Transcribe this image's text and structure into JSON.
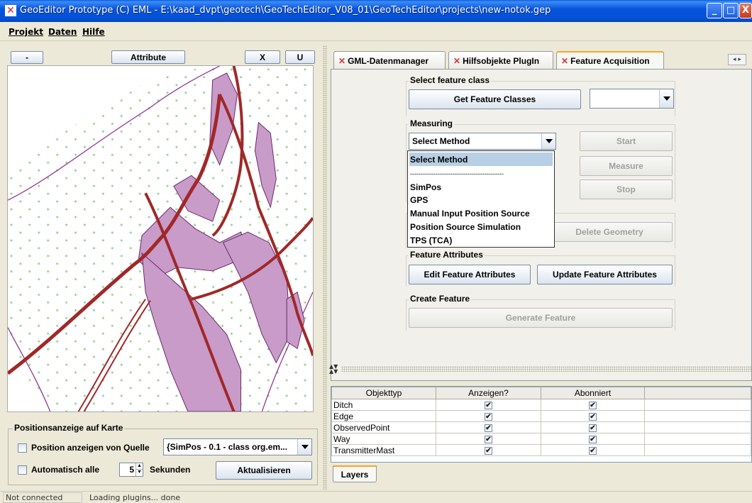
{
  "window": {
    "title": "GeoEditor Prototype (C) EML - E:\\kaad_dvpt\\geotech\\GeoTechEditor_V08_01\\GeoTechEditor\\projects\\new-notok.gep",
    "minimize": "_",
    "maximize": "□",
    "close": "X"
  },
  "menu": {
    "items": [
      "Projekt",
      "Daten",
      "Hilfe"
    ]
  },
  "left": {
    "minus_button": "-",
    "attribute_button": "Attribute",
    "x_button": "X",
    "u_button": "U",
    "position_group_title": "Positionsanzeige auf Karte",
    "show_position_label": "Position anzeigen von Quelle",
    "source_combo_value": "{SimPos - 0.1 - class org.em...",
    "auto_all_label": "Automatisch alle",
    "seconds_value": "5",
    "seconds_label": "Sekunden",
    "refresh_button": "Aktualisieren"
  },
  "tabs": [
    "GML-Datenmanager",
    "Hilfsobjekte PlugIn",
    "Feature Acquisition"
  ],
  "active_tab": "Feature Acquisition",
  "feature": {
    "select_class_title": "Select feature class",
    "get_classes_button": "Get Feature Classes",
    "class_combo_value": "",
    "measuring_title": "Measuring",
    "method_combo_value": "Select Method",
    "start_button": "Start",
    "measure_button": "Measure",
    "stop_button": "Stop",
    "delete_geometry_button": "Delete Geometry",
    "attributes_title": "Feature Attributes",
    "edit_attributes_button": "Edit Feature Attributes",
    "update_attributes_button": "Update Feature Attributes",
    "create_title": "Create Feature",
    "generate_button": "Generate Feature"
  },
  "method_options": [
    "Select Method",
    "--------------------------------------------",
    "SimPos",
    "GPS",
    "Manual Input Position Source",
    "Position Source Simulation",
    "TPS (TCA)"
  ],
  "layers": {
    "headers": [
      "Objekttyp",
      "Anzeigen?",
      "Abonniert",
      ""
    ],
    "rows": [
      {
        "name": "Ditch",
        "show": "✔",
        "subscribed": "✔"
      },
      {
        "name": "Edge",
        "show": "✔",
        "subscribed": "✔"
      },
      {
        "name": "ObservedPoint",
        "show": "✔",
        "subscribed": "✔"
      },
      {
        "name": "Way",
        "show": "✔",
        "subscribed": "✔"
      },
      {
        "name": "TransmitterMast",
        "show": "✔",
        "subscribed": "✔"
      }
    ],
    "tab_label": "Layers"
  },
  "status": {
    "connection": "Not connected",
    "message": "Loading plugins... done"
  }
}
